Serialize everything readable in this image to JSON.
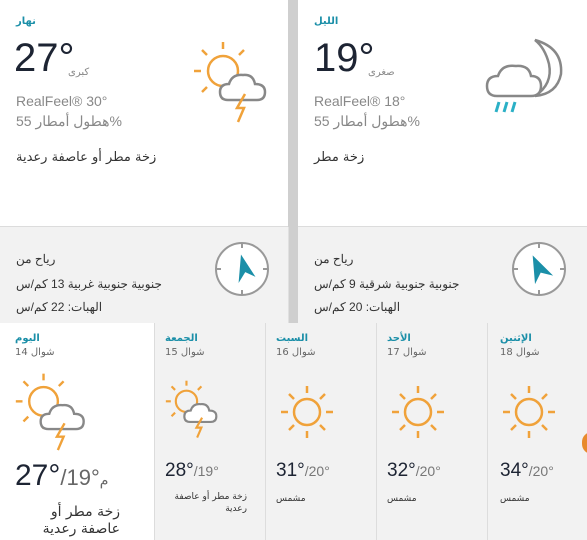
{
  "day": {
    "label": "نهار",
    "temp": "27°",
    "tag": "كبرى",
    "realfeel": "RealFeel® 30°",
    "precip": "%هطول أمطار 55",
    "phrase": "زخة مطر أو عاصفة رعدية",
    "icon": "partly-sunny-thunderstorm-icon"
  },
  "night": {
    "label": "الليل",
    "temp": "19°",
    "tag": "صغرى",
    "realfeel": "RealFeel® 18°",
    "precip": "%هطول أمطار 55",
    "phrase": "زخة مطر",
    "icon": "moon-cloud-rain-icon"
  },
  "wind_day": {
    "title": "رياح من",
    "direction": "جنوبية جنوبية غربية 13 كم/س",
    "gusts": "الهبات: 22 كم/س"
  },
  "wind_night": {
    "title": "رياح من",
    "direction": "جنوبية جنوبية شرقية 9 كم/س",
    "gusts": "الهبات: 20 كم/س"
  },
  "forecast": [
    {
      "day": "اليوم",
      "date": "شوال 14",
      "hi": "27°",
      "lo": "/19°",
      "suffix": "م",
      "phrase": "زخة مطر أو عاصفة رعدية",
      "icon": "partly-sunny-thunderstorm-icon"
    },
    {
      "day": "الجمعة",
      "date": "شوال 15",
      "hi": "28°",
      "lo": "/19°",
      "phrase": "زخة مطر أو عاصفة رعدية",
      "icon": "partly-sunny-thunderstorm-icon"
    },
    {
      "day": "السبت",
      "date": "شوال 16",
      "hi": "31°",
      "lo": "/20°",
      "phrase": "مشمس",
      "icon": "sun-icon"
    },
    {
      "day": "الأحد",
      "date": "شوال 17",
      "hi": "32°",
      "lo": "/20°",
      "phrase": "مشمس",
      "icon": "sun-icon"
    },
    {
      "day": "الإثنين",
      "date": "شوال 18",
      "hi": "34°",
      "lo": "/20°",
      "phrase": "مشمس",
      "icon": "sun-icon"
    }
  ],
  "colors": {
    "accent": "#1b8fa8",
    "sun": "#f0a23a",
    "lightning": "#f0a23a",
    "rain": "#2bb0c6"
  }
}
